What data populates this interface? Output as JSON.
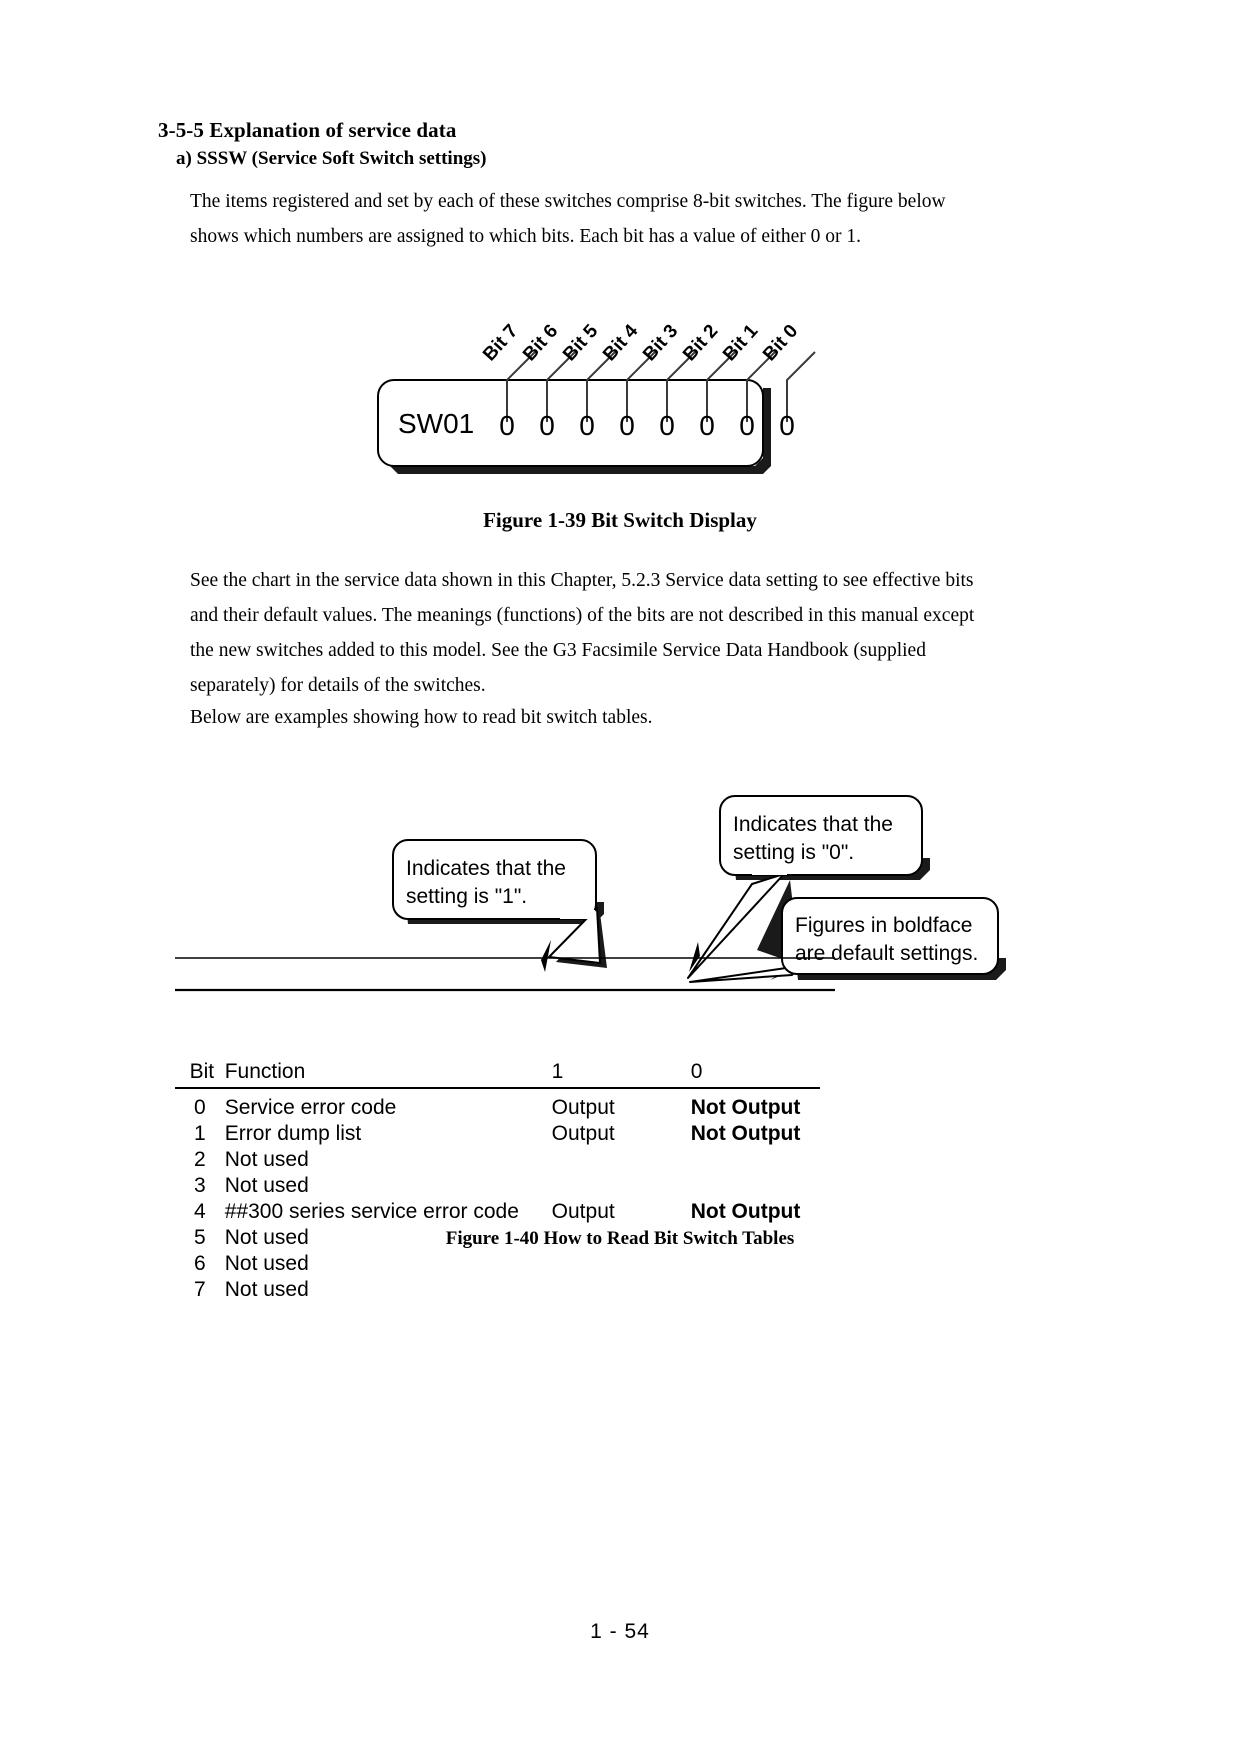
{
  "document": {
    "section_heading": "3-5-5 Explanation of service data",
    "sub_heading": "a) SSSW (Service Soft Switch settings)",
    "paragraph_intro": "The items registered and set by each of these switches comprise 8-bit switches. The figure below shows which numbers are assigned to which bits. Each bit has a value of either 0 or 1.",
    "paragraph_chart": "See the chart in the service data shown in this Chapter, 5.2.3 Service data setting to see effective bits and their default values. The meanings (functions) of the bits are not described in this manual except the new switches added to this model. See the G3 Facsimile Service Data Handbook (supplied separately) for details of the switches.",
    "paragraph_below": "Below are examples showing how to read bit switch tables.",
    "page_number": "1 - 54"
  },
  "figure_1_39": {
    "caption": "Figure 1-39 Bit Switch Display",
    "switch_name": "SW01",
    "bit_labels": [
      "Bit 7",
      "Bit 6",
      "Bit 5",
      "Bit 4",
      "Bit 3",
      "Bit 2",
      "Bit 1",
      "Bit 0"
    ],
    "bit_values": [
      "0",
      "0",
      "0",
      "0",
      "0",
      "0",
      "0",
      "0"
    ]
  },
  "figure_1_40": {
    "caption": "Figure 1-40 How to Read Bit Switch Tables",
    "callouts": [
      {
        "id": "callout-setting-1",
        "line1": "Indicates that the",
        "line2": "setting is \"1\"."
      },
      {
        "id": "callout-setting-0",
        "line1": "Indicates that the",
        "line2": "setting is \"0\"."
      },
      {
        "id": "callout-boldface",
        "line1": "Figures in boldface",
        "line2": "are default settings."
      }
    ],
    "table": {
      "headers": {
        "bit": "Bit",
        "function": "Function",
        "one": "1",
        "zero": "0"
      },
      "rows": [
        {
          "bit": "0",
          "function": "Service error code",
          "one": "Output",
          "zero": "Not Output"
        },
        {
          "bit": "1",
          "function": "Error dump list",
          "one": "Output",
          "zero": "Not Output"
        },
        {
          "bit": "2",
          "function": "Not used",
          "one": "",
          "zero": ""
        },
        {
          "bit": "3",
          "function": "Not used",
          "one": "",
          "zero": ""
        },
        {
          "bit": "4",
          "function": "##300 series service error code",
          "one": "Output",
          "zero": "Not Output"
        },
        {
          "bit": "5",
          "function": "Not used",
          "one": "",
          "zero": ""
        },
        {
          "bit": "6",
          "function": "Not used",
          "one": "",
          "zero": ""
        },
        {
          "bit": "7",
          "function": "Not used",
          "one": "",
          "zero": ""
        }
      ]
    }
  },
  "colors": {
    "ink": "#000000",
    "paper": "#ffffff",
    "shadow": "#1a1a1a"
  }
}
